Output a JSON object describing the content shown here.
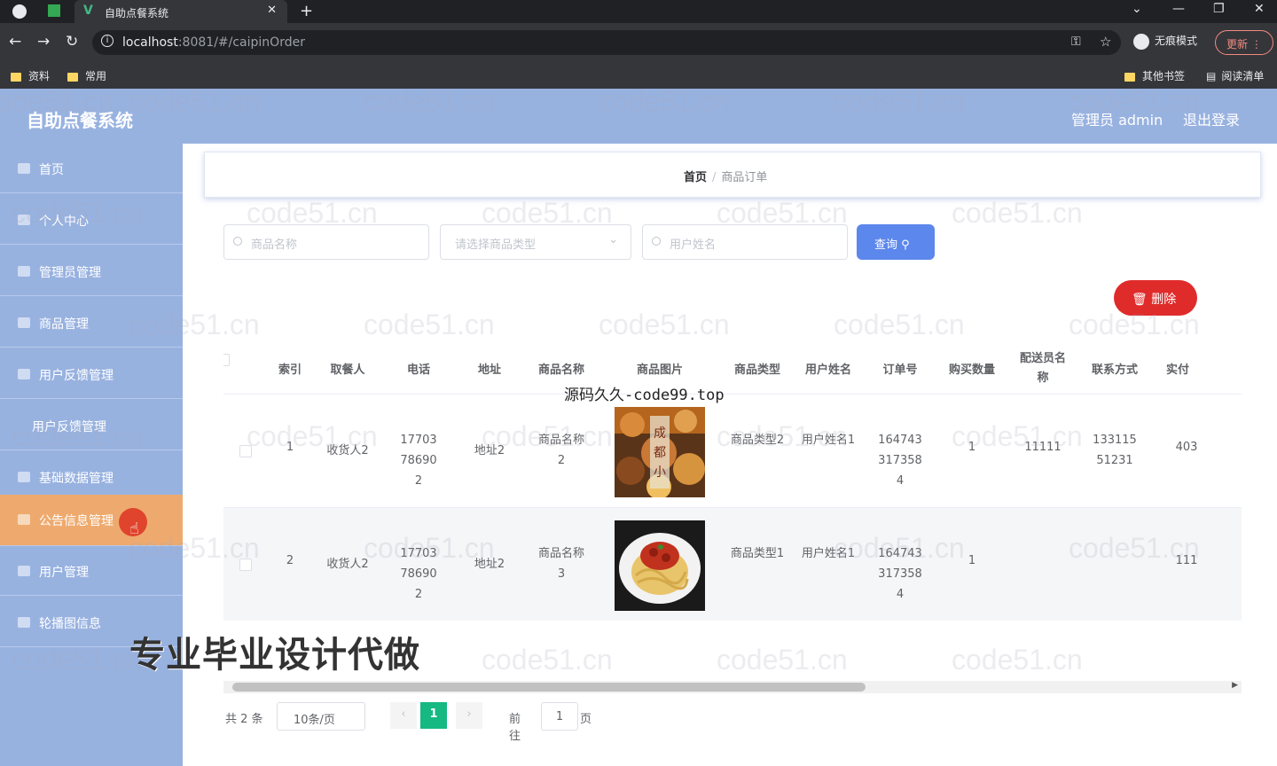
{
  "browser": {
    "tab_title": "自助点餐系统",
    "url_host": "localhost",
    "url_rest": ":8081/#/caipinOrder",
    "incognito": "无痕模式",
    "update": "更新",
    "bookmarks": [
      "资料",
      "常用"
    ],
    "bookmarks_right": [
      "其他书签",
      "阅读清单"
    ]
  },
  "header": {
    "title": "自助点餐系统",
    "admin": "管理员 admin",
    "logout": "退出登录"
  },
  "sidebar": {
    "items": [
      {
        "label": "首页"
      },
      {
        "label": "个人中心"
      },
      {
        "label": "管理员管理"
      },
      {
        "label": "商品管理"
      },
      {
        "label": "用户反馈管理"
      },
      {
        "label": "用户反馈管理"
      },
      {
        "label": "基础数据管理"
      },
      {
        "label": "公告信息管理"
      },
      {
        "label": "用户管理"
      },
      {
        "label": "轮播图信息"
      }
    ]
  },
  "breadcrumb": {
    "home": "首页",
    "sep": "/",
    "current": "商品订单"
  },
  "search": {
    "name_placeholder": "商品名称",
    "type_placeholder": "请选择商品类型",
    "user_placeholder": "用户姓名",
    "query_label": "查询"
  },
  "delete_label": "删除",
  "table": {
    "headers": [
      "索引",
      "取餐人",
      "电话",
      "地址",
      "商品名称",
      "商品图片",
      "商品类型",
      "用户姓名",
      "订单号",
      "购买数量",
      "配送员名称",
      "联系方式",
      "实付"
    ],
    "rows": [
      {
        "index": "1",
        "recipient": "收货人2",
        "phone": "17703786902",
        "address": "地址2",
        "product": "商品名称2",
        "type": "商品类型2",
        "user": "用户姓名1",
        "order_no": "1647433173584",
        "qty": "1",
        "courier": "11111",
        "contact": "13311551231",
        "paid": "403"
      },
      {
        "index": "2",
        "recipient": "收货人2",
        "phone": "17703786902",
        "address": "地址2",
        "product": "商品名称3",
        "type": "商品类型1",
        "user": "用户姓名1",
        "order_no": "1647433173584",
        "qty": "1",
        "courier": "",
        "contact": "",
        "paid": "111"
      }
    ]
  },
  "pager": {
    "total": "共 2 条",
    "size": "10条/页",
    "current": "1",
    "goto": "前往",
    "goto_value": "1",
    "page_word": "页"
  },
  "overlays": {
    "source": "源码久久-code99.top",
    "ad": "专业毕业设计代做",
    "watermark": "code51.cn"
  }
}
